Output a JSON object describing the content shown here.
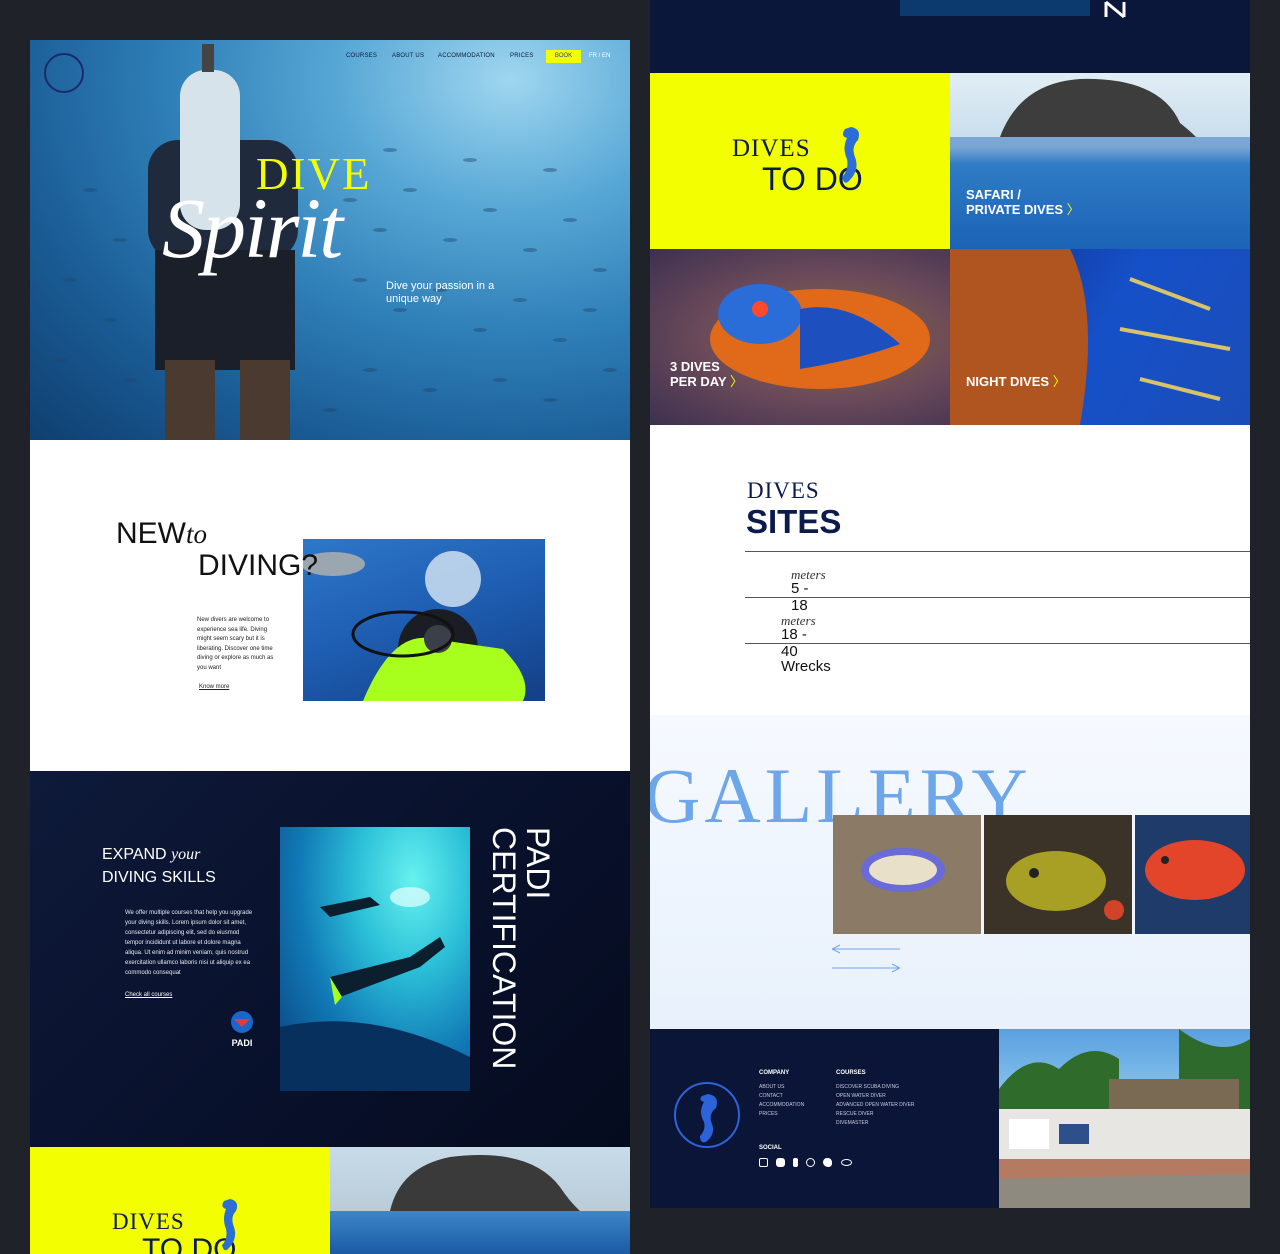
{
  "hero": {
    "nav": [
      "COURSES",
      "ABOUT US",
      "ACCOMMODATION",
      "PRICES"
    ],
    "book": "BOOK",
    "lang": "FR / EN",
    "title_dive": "DIVE",
    "title_spirit": "Spirit",
    "tagline": "Dive your passion in a unique way"
  },
  "new_to_diving": {
    "title_new": "NEW",
    "title_to": "to",
    "title_diving": "DIVING?",
    "text": "New divers are welcome to experience sea life. Diving might seem scary but it is liberating. Discover one time diving or explore as much as you want",
    "link": "Know more"
  },
  "padi": {
    "title_expand": "EXPAND",
    "title_your": "your",
    "title_skills": "DIVING SKILLS",
    "text": "We offer multiple courses that help you upgrade your diving skills. Lorem ipsum dolor sit amet, consectetur adipiscing elit, sed do eiusmod tempor incididunt ut labore et dolore magna aliqua. Ut enim ad minim veniam, quis nostrud exercitation ullamco laboris nisi ut aliquip ex ea commodo consequat",
    "link": "Check all courses",
    "logo_text": "PADI",
    "vertical_a": "PADI",
    "vertical_b": "CERTIFICATION"
  },
  "dives_to_do": {
    "title_a": "DIVES",
    "title_b": "TO DO",
    "tiles": [
      {
        "label_a": "SAFARI /",
        "label_b": "PRIVATE DIVES"
      },
      {
        "label_a": "3 DIVES",
        "label_b": "PER DAY"
      },
      {
        "label_a": "",
        "label_b": "NIGHT DIVES"
      }
    ],
    "arrow": "〉"
  },
  "sites": {
    "title_a": "DIVES",
    "title_b": "SITES",
    "rows": [
      {
        "value": "5 - 18",
        "unit": "meters"
      },
      {
        "value": "18 - 40",
        "unit": "meters"
      },
      {
        "value": "Wrecks",
        "unit": ""
      }
    ]
  },
  "gallery": {
    "title": "GALLERY"
  },
  "footer": {
    "company_title": "COMPANY",
    "company_links": [
      "ABOUT US",
      "CONTACT",
      "ACCOMMODATION",
      "PRICES"
    ],
    "courses_title": "COURSES",
    "courses_links": [
      "DISCOVER SCUBA DIVING",
      "OPEN WATER DIVER",
      "ADVANCED OPEN WATER DIVER",
      "RESCUE DIVER",
      "DIVEMASTER"
    ],
    "social_title": "SOCIAL",
    "social_icons": [
      "instagram-icon",
      "youtube-icon",
      "facebook-icon",
      "whatsapp-icon",
      "twitter-icon",
      "tripadvisor-icon"
    ]
  },
  "colors": {
    "accent_yellow": "#f3ff00",
    "navy": "#0a1538",
    "gallery_blue": "#6da6e9"
  }
}
